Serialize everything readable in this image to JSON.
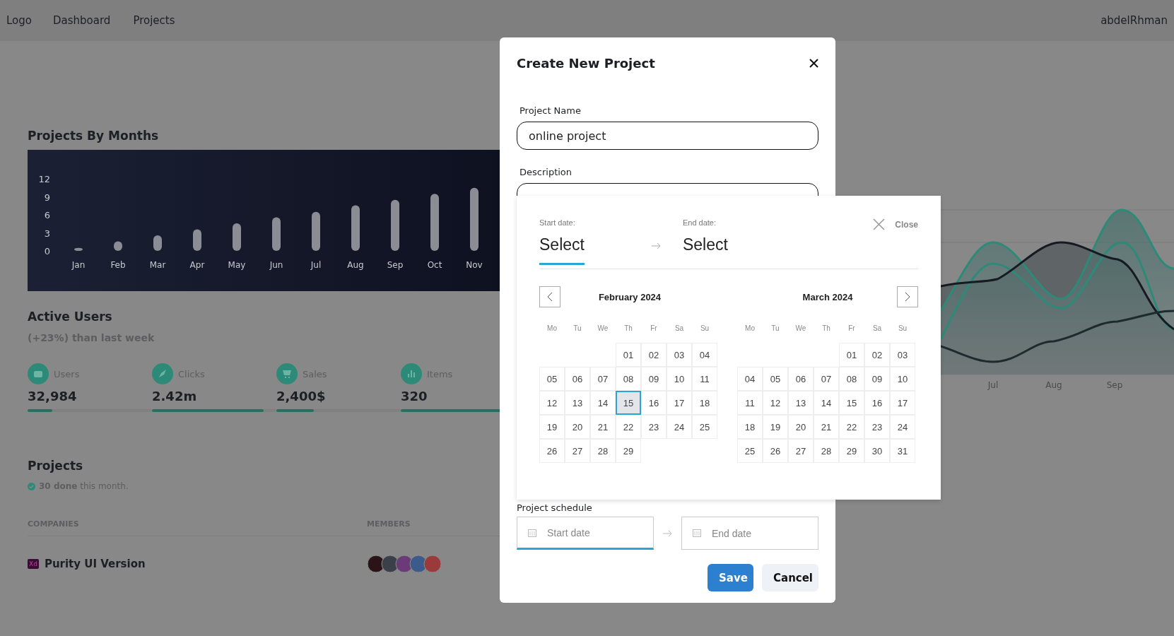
{
  "navbar": {
    "logo": "Logo",
    "links": [
      "Dashboard",
      "Projects"
    ],
    "user": "abdelRhman"
  },
  "projects_by_months": {
    "title": "Projects By Months",
    "chart_data": {
      "type": "bar",
      "categories": [
        "Jan",
        "Feb",
        "Mar",
        "Apr",
        "May",
        "Jun",
        "Jul",
        "Aug",
        "Sep",
        "Oct",
        "Nov"
      ],
      "values": [
        0.5,
        1.6,
        2.6,
        3.6,
        4.6,
        5.6,
        6.5,
        7.6,
        8.5,
        9.5,
        10.5
      ],
      "yticks": [
        0,
        3,
        6,
        9,
        12
      ],
      "ylim": [
        0,
        12
      ]
    }
  },
  "active_users": {
    "title": "Active Users",
    "subtitle": "**(+23%)** than last week",
    "stats": [
      {
        "label": "Users",
        "value": "32,984",
        "level": 0.2
      },
      {
        "label": "Clicks",
        "value": "2.42m",
        "level": 0.9
      },
      {
        "label": "Sales",
        "value": "2,400$",
        "level": 0.3
      },
      {
        "label": "Items",
        "value": "320",
        "level": 0.9
      }
    ]
  },
  "side_chart": {
    "x_labels": [
      "Jul",
      "Aug",
      "Sep"
    ]
  },
  "projects": {
    "title": "Projects",
    "summary": "**30 done** this month.",
    "columns": [
      "COMPANIES",
      "MEMBERS"
    ],
    "rows": [
      {
        "logo_text": "Xd",
        "company": "Purity UI Version",
        "members": [
          {
            "color": "#2a1418"
          },
          {
            "color": "#3b3f4a"
          },
          {
            "color": "#6a3b78"
          },
          {
            "color": "#3d5a8c"
          },
          {
            "color": "#9a3a3a"
          }
        ]
      }
    ]
  },
  "modal": {
    "title": "Create New Project",
    "fields": [
      {
        "label": "Project Name",
        "value": "online project"
      },
      {
        "label": "Description"
      }
    ],
    "schedule": {
      "label": "Project schedule",
      "start": {
        "placeholder": "Start date",
        "focused": true
      },
      "end": {
        "placeholder": "End date",
        "focused": false
      }
    },
    "buttons": [
      {
        "label": "Save",
        "kind": "primary"
      },
      {
        "label": "Cancel",
        "kind": "secondary"
      }
    ]
  },
  "date_picker": {
    "tabs": [
      {
        "label": "Start date:",
        "value": "Select",
        "selected": true
      },
      {
        "label": "End date:",
        "value": "Select",
        "selected": false
      }
    ],
    "close": "Close",
    "months": [
      {
        "title": "February 2024",
        "weekdays": [
          "Mo",
          "Tu",
          "We",
          "Th",
          "Fr",
          "Sa",
          "Su"
        ],
        "weeks": [
          [
            {
              "kind": "blank"
            },
            {
              "kind": "blank"
            },
            {
              "kind": "blank"
            },
            {
              "day": "01",
              "hovered": false
            },
            {
              "day": "02",
              "hovered": false
            },
            {
              "day": "03",
              "hovered": false
            },
            {
              "day": "04",
              "hovered": false
            }
          ],
          [
            {
              "day": "05",
              "hovered": false
            },
            {
              "day": "06",
              "hovered": false
            },
            {
              "day": "07",
              "hovered": false
            },
            {
              "day": "08",
              "hovered": false
            },
            {
              "day": "09",
              "hovered": false
            },
            {
              "day": "10",
              "hovered": false
            },
            {
              "day": "11",
              "hovered": false
            }
          ],
          [
            {
              "day": "12",
              "hovered": false
            },
            {
              "day": "13",
              "hovered": false
            },
            {
              "day": "14",
              "hovered": false
            },
            {
              "day": "15",
              "hovered": true
            },
            {
              "day": "16",
              "hovered": false
            },
            {
              "day": "17",
              "hovered": false
            },
            {
              "day": "18",
              "hovered": false
            }
          ],
          [
            {
              "day": "19",
              "hovered": false
            },
            {
              "day": "20",
              "hovered": false
            },
            {
              "day": "21",
              "hovered": false
            },
            {
              "day": "22",
              "hovered": false
            },
            {
              "day": "23",
              "hovered": false
            },
            {
              "day": "24",
              "hovered": false
            },
            {
              "day": "25",
              "hovered": false
            }
          ],
          [
            {
              "day": "26",
              "hovered": false
            },
            {
              "day": "27",
              "hovered": false
            },
            {
              "day": "28",
              "hovered": false
            },
            {
              "day": "29",
              "hovered": false
            },
            {
              "kind": "blank"
            },
            {
              "kind": "blank"
            },
            {
              "kind": "blank"
            }
          ]
        ]
      },
      {
        "title": "March 2024",
        "weekdays": [
          "Mo",
          "Tu",
          "We",
          "Th",
          "Fr",
          "Sa",
          "Su"
        ],
        "weeks": [
          [
            {
              "kind": "blank"
            },
            {
              "kind": "blank"
            },
            {
              "kind": "blank"
            },
            {
              "kind": "blank"
            },
            {
              "day": "01",
              "hovered": false
            },
            {
              "day": "02",
              "hovered": false
            },
            {
              "day": "03",
              "hovered": false
            }
          ],
          [
            {
              "day": "04",
              "hovered": false
            },
            {
              "day": "05",
              "hovered": false
            },
            {
              "day": "06",
              "hovered": false
            },
            {
              "day": "07",
              "hovered": false
            },
            {
              "day": "08",
              "hovered": false
            },
            {
              "day": "09",
              "hovered": false
            },
            {
              "day": "10",
              "hovered": false
            }
          ],
          [
            {
              "day": "11",
              "hovered": false
            },
            {
              "day": "12",
              "hovered": false
            },
            {
              "day": "13",
              "hovered": false
            },
            {
              "day": "14",
              "hovered": false
            },
            {
              "day": "15",
              "hovered": false
            },
            {
              "day": "16",
              "hovered": false
            },
            {
              "day": "17",
              "hovered": false
            }
          ],
          [
            {
              "day": "18",
              "hovered": false
            },
            {
              "day": "19",
              "hovered": false
            },
            {
              "day": "20",
              "hovered": false
            },
            {
              "day": "21",
              "hovered": false
            },
            {
              "day": "22",
              "hovered": false
            },
            {
              "day": "23",
              "hovered": false
            },
            {
              "day": "24",
              "hovered": false
            }
          ],
          [
            {
              "day": "25",
              "hovered": false
            },
            {
              "day": "26",
              "hovered": false
            },
            {
              "day": "27",
              "hovered": false
            },
            {
              "day": "28",
              "hovered": false
            },
            {
              "day": "29",
              "hovered": false
            },
            {
              "day": "30",
              "hovered": false
            },
            {
              "day": "31",
              "hovered": false
            }
          ]
        ]
      }
    ]
  }
}
